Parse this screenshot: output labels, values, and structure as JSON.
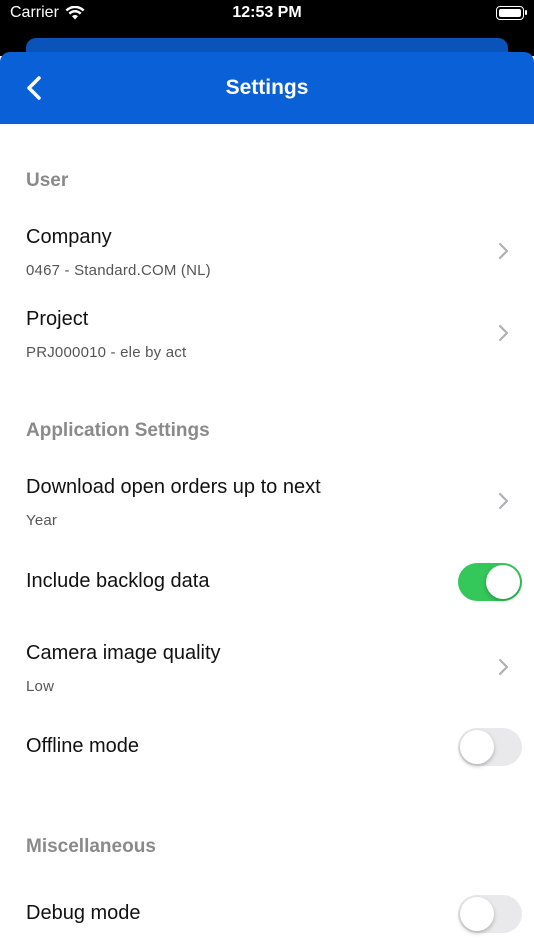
{
  "status_bar": {
    "carrier": "Carrier",
    "time": "12:53 PM"
  },
  "nav": {
    "title": "Settings",
    "back_icon": "chevron-left-icon"
  },
  "sections": {
    "user": {
      "header": "User",
      "company": {
        "title": "Company",
        "subtitle": "0467  -  Standard.COM (NL)"
      },
      "project": {
        "title": "Project",
        "subtitle": "PRJ000010  -  ele by act"
      }
    },
    "app": {
      "header": "Application Settings",
      "download": {
        "title": "Download open orders up to next",
        "subtitle": "Year"
      },
      "backlog": {
        "title": "Include backlog data",
        "enabled": true
      },
      "camera": {
        "title": "Camera image quality",
        "subtitle": "Low"
      },
      "offline": {
        "title": "Offline mode",
        "enabled": false
      }
    },
    "misc": {
      "header": "Miscellaneous",
      "debug": {
        "title": "Debug mode",
        "enabled": false
      }
    }
  },
  "colors": {
    "nav_blue": "#0a60d6",
    "toggle_on": "#34c759",
    "toggle_off": "#e9e9eb"
  }
}
